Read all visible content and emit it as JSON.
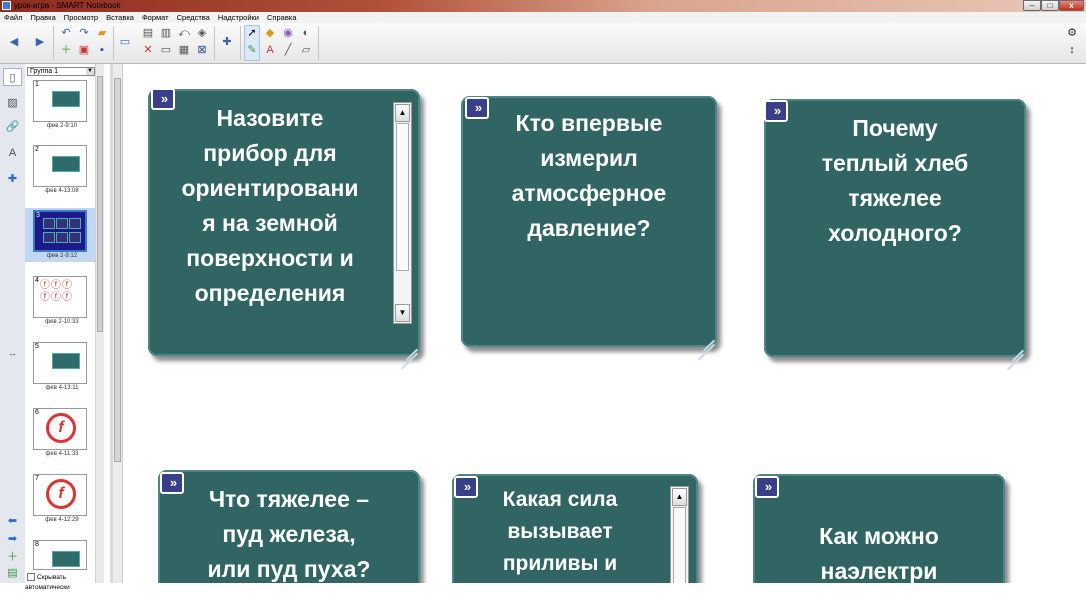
{
  "window": {
    "title": "урок-игра - SMART Notebook",
    "min_label": "–",
    "max_label": "□",
    "close_label": "x"
  },
  "menu": [
    "Файл",
    "Правка",
    "Просмотр",
    "Вставка",
    "Формат",
    "Средства",
    "Надстройки",
    "Справка"
  ],
  "toolbar": {
    "back_icon": "arrow-left-icon",
    "forward_icon": "arrow-right-icon",
    "tools_active": "select-arrow"
  },
  "sidebar": {
    "group_select": "Группа 1",
    "autohide_label": "Скрывать автоматически",
    "thumbnails": [
      {
        "num": "1",
        "label": "фев 2-9:10"
      },
      {
        "num": "2",
        "label": "фев 4-13:08"
      },
      {
        "num": "3",
        "label": "фев 2-9:12"
      },
      {
        "num": "4",
        "label": "фев 2-10:33"
      },
      {
        "num": "5",
        "label": "фев 4-13:11"
      },
      {
        "num": "6",
        "label": "фев 4-11:33"
      },
      {
        "num": "7",
        "label": "фев 4-12:29"
      },
      {
        "num": "8",
        "label": ""
      }
    ]
  },
  "cards": [
    {
      "text": [
        "Назовите",
        "прибор для",
        "ориентировани",
        "я на земной",
        "поверхности и",
        "определения"
      ]
    },
    {
      "text": [
        "Кто впервые",
        "измерил",
        "атмосферное",
        "давление?"
      ]
    },
    {
      "text": [
        "Почему",
        "теплый хлеб",
        "тяжелее",
        "холодного?"
      ]
    },
    {
      "text": [
        "Что тяжелее –",
        "пуд железа,",
        "или пуд пуха?"
      ]
    },
    {
      "text": [
        "Какая  сила",
        "вызывает",
        "приливы и"
      ]
    },
    {
      "text": [
        "Как можно",
        "наэлектри"
      ]
    }
  ],
  "colors": {
    "card": "#306563",
    "card_border": "#4d8684",
    "card_icon": "#3a3f8c"
  }
}
